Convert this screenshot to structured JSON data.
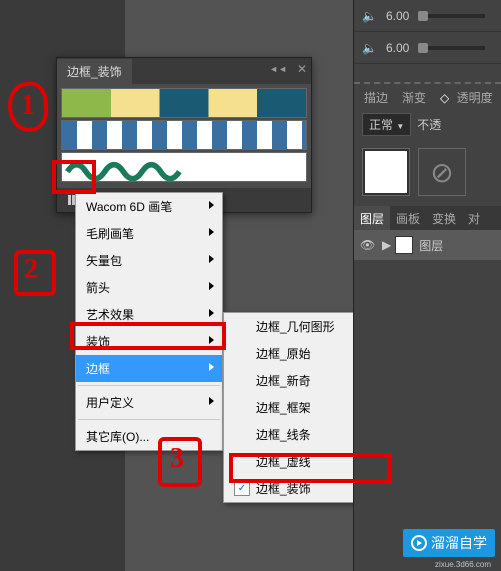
{
  "panel": {
    "tab": "边框_装饰"
  },
  "menu": {
    "wacom": "Wacom 6D 画笔",
    "brush": "毛刷画笔",
    "vector": "矢量包",
    "arrow": "箭头",
    "art": "艺术效果",
    "decor": "装饰",
    "border": "边框",
    "userdef": "用户定义",
    "otherlib": "其它库(O)..."
  },
  "submenu": {
    "geom": "边框_几何图形",
    "orig": "边框_原始",
    "novel": "边框_新奇",
    "frame": "边框_框架",
    "lines": "边框_线条",
    "dash": "边框_虚线",
    "decor": "边框_装饰"
  },
  "right": {
    "vol1": "6.00",
    "vol2": "6.00",
    "tabs": {
      "stroke": "描边",
      "grad": "渐变",
      "opacity": "透明度"
    },
    "blend": "正常",
    "nopreserve": "不透",
    "layertabs": {
      "layers": "图层",
      "artboard": "画板",
      "transform": "变换",
      "d": "对"
    },
    "layername": "图层"
  },
  "annotations": {
    "n1": "1",
    "n2": "2",
    "n3": "3"
  },
  "watermark": {
    "text": "溜溜自学",
    "url": "zixue.3d66.com"
  }
}
